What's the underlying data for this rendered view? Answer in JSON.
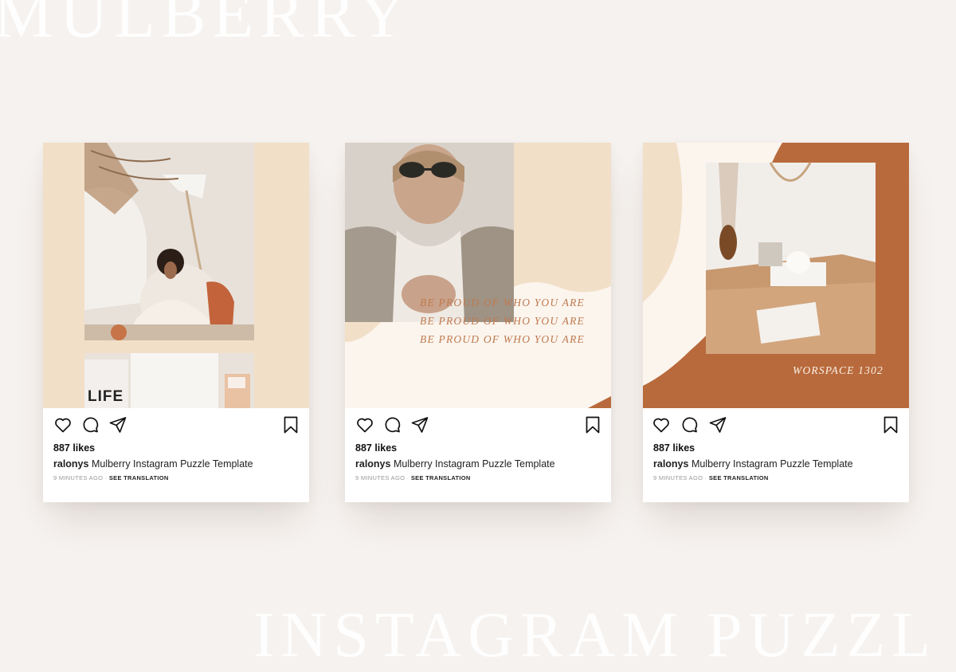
{
  "background": {
    "top_word": "MULBERRY",
    "bottom_word": "INSTAGRAM PUZZL"
  },
  "colors": {
    "page_bg": "#f6f2ef",
    "peach": "#f2dfc8",
    "cream": "#fbf5ee",
    "rust": "#b86a3c",
    "text_accent": "#c07a4f"
  },
  "posts": [
    {
      "likes": "887 likes",
      "username": "ralonys",
      "caption": "Mulberry Instagram Puzzle Template",
      "time": "9 MINUTES AGO",
      "separator": "·",
      "translation": "SEE TRANSLATION",
      "image_text": "LIFE"
    },
    {
      "likes": "887 likes",
      "username": "ralonys",
      "caption": "Mulberry Instagram Puzzle Template",
      "time": "9 MINUTES AGO",
      "separator": "·",
      "translation": "SEE TRANSLATION",
      "overlay_lines": [
        "BE PROUD OF WHO YOU ARE",
        "BE PROUD OF WHO YOU ARE",
        "BE PROUD OF WHO YOU ARE"
      ]
    },
    {
      "likes": "887 likes",
      "username": "ralonys",
      "caption": "Mulberry Instagram Puzzle Template",
      "time": "9 MINUTES AGO",
      "separator": "·",
      "translation": "SEE TRANSLATION",
      "overlay_label": "WORSPACE 1302"
    }
  ],
  "icons": [
    "heart-icon",
    "comment-icon",
    "share-icon",
    "bookmark-icon"
  ]
}
